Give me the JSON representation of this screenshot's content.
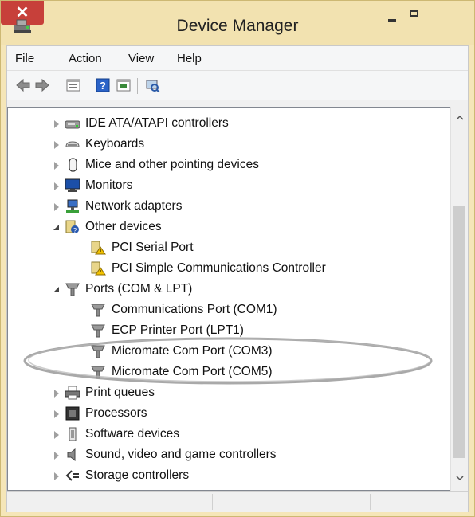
{
  "window": {
    "title": "Device Manager",
    "close_glyph": "✕"
  },
  "menu": {
    "file": "File",
    "action": "Action",
    "view": "View",
    "help": "Help"
  },
  "toolbar": {
    "icons": [
      "back-arrow-icon",
      "forward-arrow-icon",
      "properties-icon",
      "help-icon",
      "show-hidden-icon",
      "scan-hardware-icon"
    ]
  },
  "tree": {
    "ide": "IDE ATA/ATAPI controllers",
    "keyboards": "Keyboards",
    "mice": "Mice and other pointing devices",
    "monitors": "Monitors",
    "network": "Network adapters",
    "other": "Other devices",
    "pci_serial": "PCI Serial Port",
    "pci_simple": "PCI Simple Communications Controller",
    "ports": "Ports (COM & LPT)",
    "com1": "Communications Port (COM1)",
    "lpt1": "ECP Printer Port (LPT1)",
    "com3": "Micromate Com Port (COM3)",
    "com5": "Micromate Com Port (COM5)",
    "print": "Print queues",
    "processors": "Processors",
    "software": "Software devices",
    "sound": "Sound, video and game controllers",
    "storage": "Storage controllers"
  },
  "colors": {
    "title_bg": "#f2e2b0",
    "close_red": "#c7403a",
    "port_grey": "#8a8a8a"
  }
}
